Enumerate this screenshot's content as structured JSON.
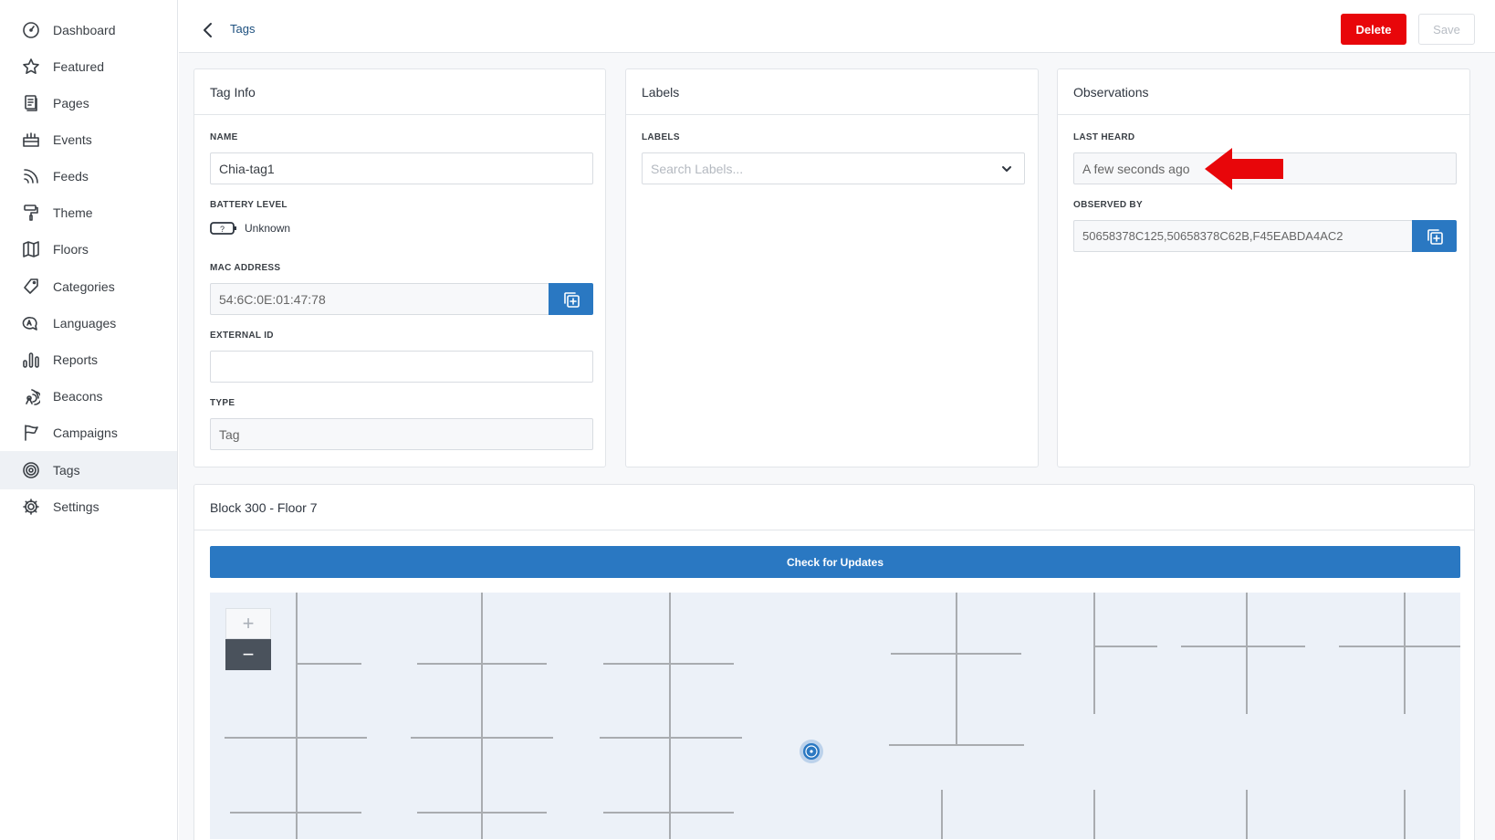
{
  "sidebar": {
    "items": [
      {
        "label": "Dashboard",
        "icon": "dashboard-icon"
      },
      {
        "label": "Featured",
        "icon": "star-icon"
      },
      {
        "label": "Pages",
        "icon": "pages-icon"
      },
      {
        "label": "Events",
        "icon": "calendar-icon"
      },
      {
        "label": "Feeds",
        "icon": "rss-icon"
      },
      {
        "label": "Theme",
        "icon": "paint-roller-icon"
      },
      {
        "label": "Floors",
        "icon": "map-icon"
      },
      {
        "label": "Categories",
        "icon": "tag-icon"
      },
      {
        "label": "Languages",
        "icon": "translate-icon"
      },
      {
        "label": "Reports",
        "icon": "bar-chart-icon"
      },
      {
        "label": "Beacons",
        "icon": "beacon-icon"
      },
      {
        "label": "Campaigns",
        "icon": "flag-icon"
      },
      {
        "label": "Tags",
        "icon": "target-icon",
        "active": true
      },
      {
        "label": "Settings",
        "icon": "gear-icon"
      }
    ]
  },
  "header": {
    "breadcrumb": "Tags",
    "delete_label": "Delete",
    "save_label": "Save"
  },
  "tag_info": {
    "title": "Tag Info",
    "name_label": "NAME",
    "name_value": "Chia-tag1",
    "battery_label": "BATTERY LEVEL",
    "battery_value": "Unknown",
    "battery_glyph": "?",
    "mac_label": "MAC ADDRESS",
    "mac_value": "54:6C:0E:01:47:78",
    "external_id_label": "EXTERNAL ID",
    "external_id_value": "",
    "type_label": "TYPE",
    "type_value": "Tag"
  },
  "labels": {
    "title": "Labels",
    "field_label": "LABELS",
    "placeholder": "Search Labels..."
  },
  "observations": {
    "title": "Observations",
    "last_heard_label": "LAST HEARD",
    "last_heard_value": "A few seconds ago",
    "observed_by_label": "OBSERVED BY",
    "observed_by_value": "50658378C125,50658378C62B,F45EABDA4AC2"
  },
  "floor": {
    "title": "Block 300 - Floor 7",
    "check_label": "Check for Updates",
    "zoom_in": "+",
    "zoom_out": "−"
  },
  "colors": {
    "primary": "#2a78c2",
    "danger": "#e8060a",
    "annotation_arrow": "#e8060a"
  }
}
